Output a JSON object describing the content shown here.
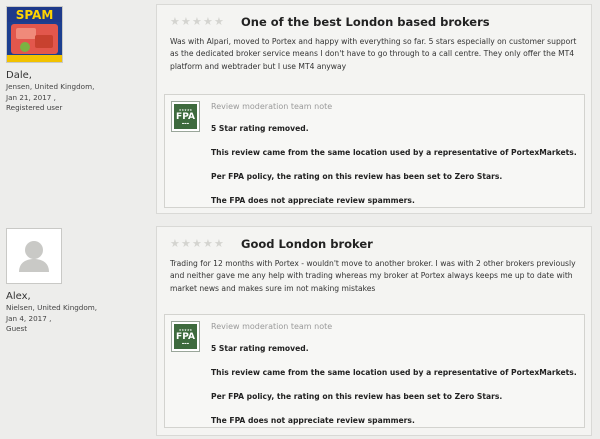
{
  "reviews": [
    {
      "author": {
        "avatar": "spam-can-image",
        "name": "Dale,",
        "location": "Jensen, United Kingdom,",
        "date": "Jan 21, 2017 ,",
        "role": "Registered user"
      },
      "rating": 0,
      "title": "One of the best London based brokers",
      "body": "Was with Alpari, moved to Portex and happy with everything so far. 5 stars especially on customer support as the dedicated broker service means I don't have to go through to a call centre. They only offer the MT4 platform and webtrader but I use MT4 anyway",
      "moderation": {
        "label": "Review moderation team note",
        "lines": [
          "5 Star rating removed.",
          "This review came from the same location used by a representative of PortexMarkets.",
          "Per FPA policy, the rating on this review has been set to Zero Stars.",
          "The FPA does not appreciate review spammers."
        ]
      }
    },
    {
      "author": {
        "avatar": "default-user-silhouette",
        "name": "Alex,",
        "location": "Nielsen, United Kingdom,",
        "date": "Jan 4, 2017 ,",
        "role": "Guest"
      },
      "rating": 0,
      "title": "Good London broker",
      "body": "Trading for 12 months with Portex - wouldn't move to another broker. I was with 2 other brokers previously and neither gave me any help with trading whereas my broker at Portex always keeps me up to date with market news and makes sure im not making mistakes",
      "moderation": {
        "label": "Review moderation team note",
        "lines": [
          "5 Star rating removed.",
          "This review came from the same location used by a representative of PortexMarkets.",
          "Per FPA policy, the rating on this review has been set to Zero Stars.",
          "The FPA does not appreciate review spammers."
        ]
      }
    }
  ],
  "badge": {
    "text": "FPA",
    "icon": "fpa-badge-icon",
    "color": "#3e6b3e"
  },
  "colors": {
    "background": "#ededeb",
    "card": "#f4f4f2",
    "empty_star": "#d4d4d0"
  }
}
